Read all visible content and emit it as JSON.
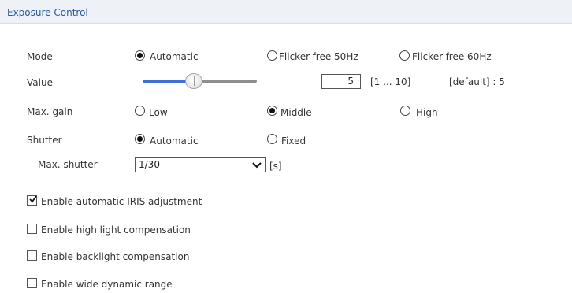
{
  "header": {
    "title": "Exposure Control"
  },
  "mode": {
    "label": "Mode",
    "options": [
      {
        "label": "Automatic",
        "checked": true
      },
      {
        "label": "Flicker-free 50Hz",
        "checked": false
      },
      {
        "label": "Flicker-free 60Hz",
        "checked": false
      }
    ]
  },
  "value": {
    "label": "Value",
    "slider_fraction": 0.46,
    "input_value": "5",
    "range_text": "[1 ... 10]",
    "default_text": "[default] : 5"
  },
  "max_gain": {
    "label": "Max. gain",
    "options": [
      {
        "label": "Low",
        "checked": false
      },
      {
        "label": "Middle",
        "checked": true
      },
      {
        "label": "High",
        "checked": false
      }
    ]
  },
  "shutter": {
    "label": "Shutter",
    "options": [
      {
        "label": "Automatic",
        "checked": true
      },
      {
        "label": "Fixed",
        "checked": false
      }
    ],
    "max_shutter_label": "Max. shutter",
    "max_shutter_value": "1/30",
    "unit": "[s]"
  },
  "checkboxes": [
    {
      "label": "Enable automatic IRIS adjustment",
      "checked": true
    },
    {
      "label": "Enable high light compensation",
      "checked": false
    },
    {
      "label": "Enable backlight compensation",
      "checked": false
    },
    {
      "label": "Enable wide dynamic range",
      "checked": false
    }
  ],
  "colors": {
    "header_bg": "#eef1f6",
    "header_text": "#2a5aa0",
    "slider_fill": "#3d6fd6"
  }
}
